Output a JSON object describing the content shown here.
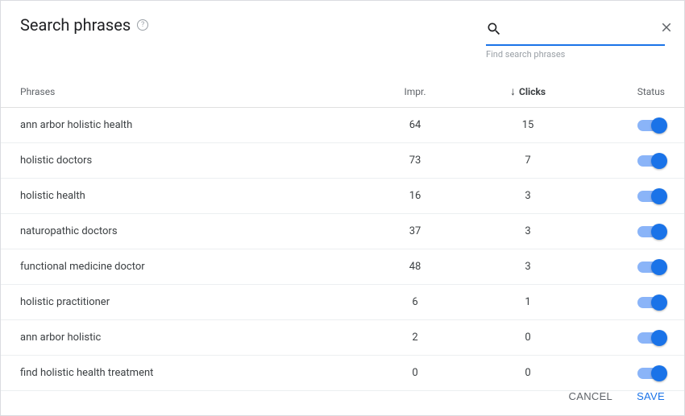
{
  "header": {
    "title": "Search phrases",
    "search_placeholder": "",
    "search_helper": "Find search phrases"
  },
  "columns": {
    "phrase": "Phrases",
    "impr": "Impr.",
    "clicks": "Clicks",
    "status": "Status"
  },
  "rows": [
    {
      "phrase": "ann arbor holistic health",
      "impr": 64,
      "clicks": 15,
      "status": true
    },
    {
      "phrase": "holistic doctors",
      "impr": 73,
      "clicks": 7,
      "status": true
    },
    {
      "phrase": "holistic health",
      "impr": 16,
      "clicks": 3,
      "status": true
    },
    {
      "phrase": "naturopathic doctors",
      "impr": 37,
      "clicks": 3,
      "status": true
    },
    {
      "phrase": "functional medicine doctor",
      "impr": 48,
      "clicks": 3,
      "status": true
    },
    {
      "phrase": "holistic practitioner",
      "impr": 6,
      "clicks": 1,
      "status": true
    },
    {
      "phrase": "ann arbor holistic",
      "impr": 2,
      "clicks": 0,
      "status": true
    },
    {
      "phrase": "find holistic health treatment",
      "impr": 0,
      "clicks": 0,
      "status": true
    }
  ],
  "footer": {
    "cancel": "CANCEL",
    "save": "SAVE"
  },
  "sort": {
    "column": "clicks",
    "direction": "desc"
  }
}
